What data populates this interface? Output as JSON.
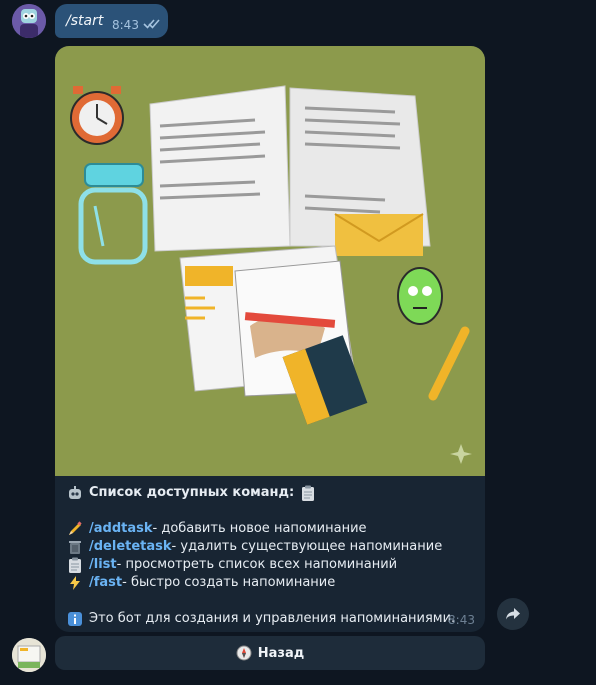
{
  "outgoing": {
    "text": "/start",
    "time": "8:43",
    "status_icon": "double-check-icon"
  },
  "incoming": {
    "title": "Список доступных команд:",
    "commands": [
      {
        "icon": "pencil-icon",
        "cmd": "/addtask",
        "desc": " - добавить новое напоминание"
      },
      {
        "icon": "trash-can-icon",
        "cmd": "/deletetask",
        "desc": " - удалить существующее напоминание"
      },
      {
        "icon": "clipboard-icon",
        "cmd": "/list",
        "desc": " - просмотреть список всех напоминаний"
      },
      {
        "icon": "lightning-icon",
        "cmd": "/fast",
        "desc": " - быстро создать напоминание"
      }
    ],
    "info": "Это бот для создания и управления напоминаниями.",
    "time": "8:43"
  },
  "keyboard": {
    "back_label": "Назад",
    "back_icon": "compass-icon"
  },
  "colors": {
    "background": "#0e1621",
    "outgoing_bubble": "#2b5278",
    "incoming_bubble": "#182533",
    "link": "#6ab3f3",
    "illustration_bg": "#8c9a4c"
  }
}
